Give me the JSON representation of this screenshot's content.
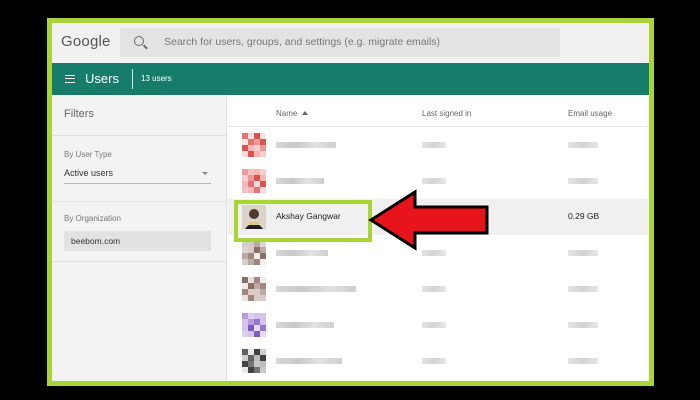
{
  "search": {
    "logo": "Google",
    "placeholder": "Search for users, groups, and settings (e.g. migrate emails)"
  },
  "header": {
    "title": "Users",
    "count": "13 users",
    "color": "#167d6b"
  },
  "sidebar": {
    "title": "Filters",
    "user_type_label": "By User Type",
    "user_type_value": "Active users",
    "organization_label": "By Organization",
    "organization_value": "beebom.com"
  },
  "table": {
    "columns": [
      "Name",
      "Last signed in",
      "Email usage"
    ],
    "sort_column": "Name",
    "rows": [
      {
        "name": "",
        "last_signed_in": "",
        "email_usage": "",
        "avatar": "red-pixelated-avatar"
      },
      {
        "name": "",
        "last_signed_in": "",
        "email_usage": "",
        "avatar": "red-pixelated-avatar"
      },
      {
        "name": "Akshay Gangwar",
        "last_signed_in": "",
        "email_usage": "0.29 GB",
        "avatar": "person-avatar",
        "selected": true
      },
      {
        "name": "",
        "last_signed_in": "",
        "email_usage": "",
        "avatar": "brown-pixelated-avatar"
      },
      {
        "name": "",
        "last_signed_in": "",
        "email_usage": "",
        "avatar": "brown-pixelated-avatar"
      },
      {
        "name": "",
        "last_signed_in": "",
        "email_usage": "",
        "avatar": "purple-pixelated-avatar"
      },
      {
        "name": "",
        "last_signed_in": "",
        "email_usage": "",
        "avatar": "dark-pixelated-avatar"
      }
    ]
  },
  "annotations": {
    "highlight_color": "#a6d535",
    "arrow_color": "#e8141c"
  }
}
